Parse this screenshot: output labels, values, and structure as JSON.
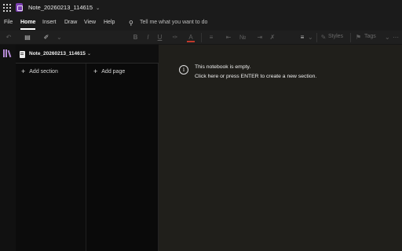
{
  "window": {
    "document_title": "Note_20260213_114615",
    "title_chevron": "⌄"
  },
  "menu": {
    "items": [
      "File",
      "Home",
      "Insert",
      "Draw",
      "View",
      "Help"
    ],
    "active": "Home",
    "tell_me": "Tell me what you want to do"
  },
  "toolbar": {
    "styles_label": "Styles",
    "tags_label": "Tags",
    "icons": [
      "undo-icon",
      "clipboard-icon",
      "format-painter-icon",
      "bold-icon",
      "italic-icon",
      "underline-icon",
      "highlight-icon",
      "font-color-icon",
      "bullet-list-icon",
      "numbered-list-icon",
      "align-icon",
      "styles-icon",
      "tags-icon",
      "more-icon"
    ]
  },
  "notebook": {
    "name": "Note_20260213_114615",
    "add_section": "Add section",
    "add_page": "Add page"
  },
  "canvas": {
    "message_line1": "This notebook is empty.",
    "message_line2": "Click here or press ENTER to create a new section."
  },
  "colors": {
    "accent_purple": "#7b3fb0",
    "canvas_bg": "#201f1b",
    "font_color_underline": "#c0392b"
  }
}
